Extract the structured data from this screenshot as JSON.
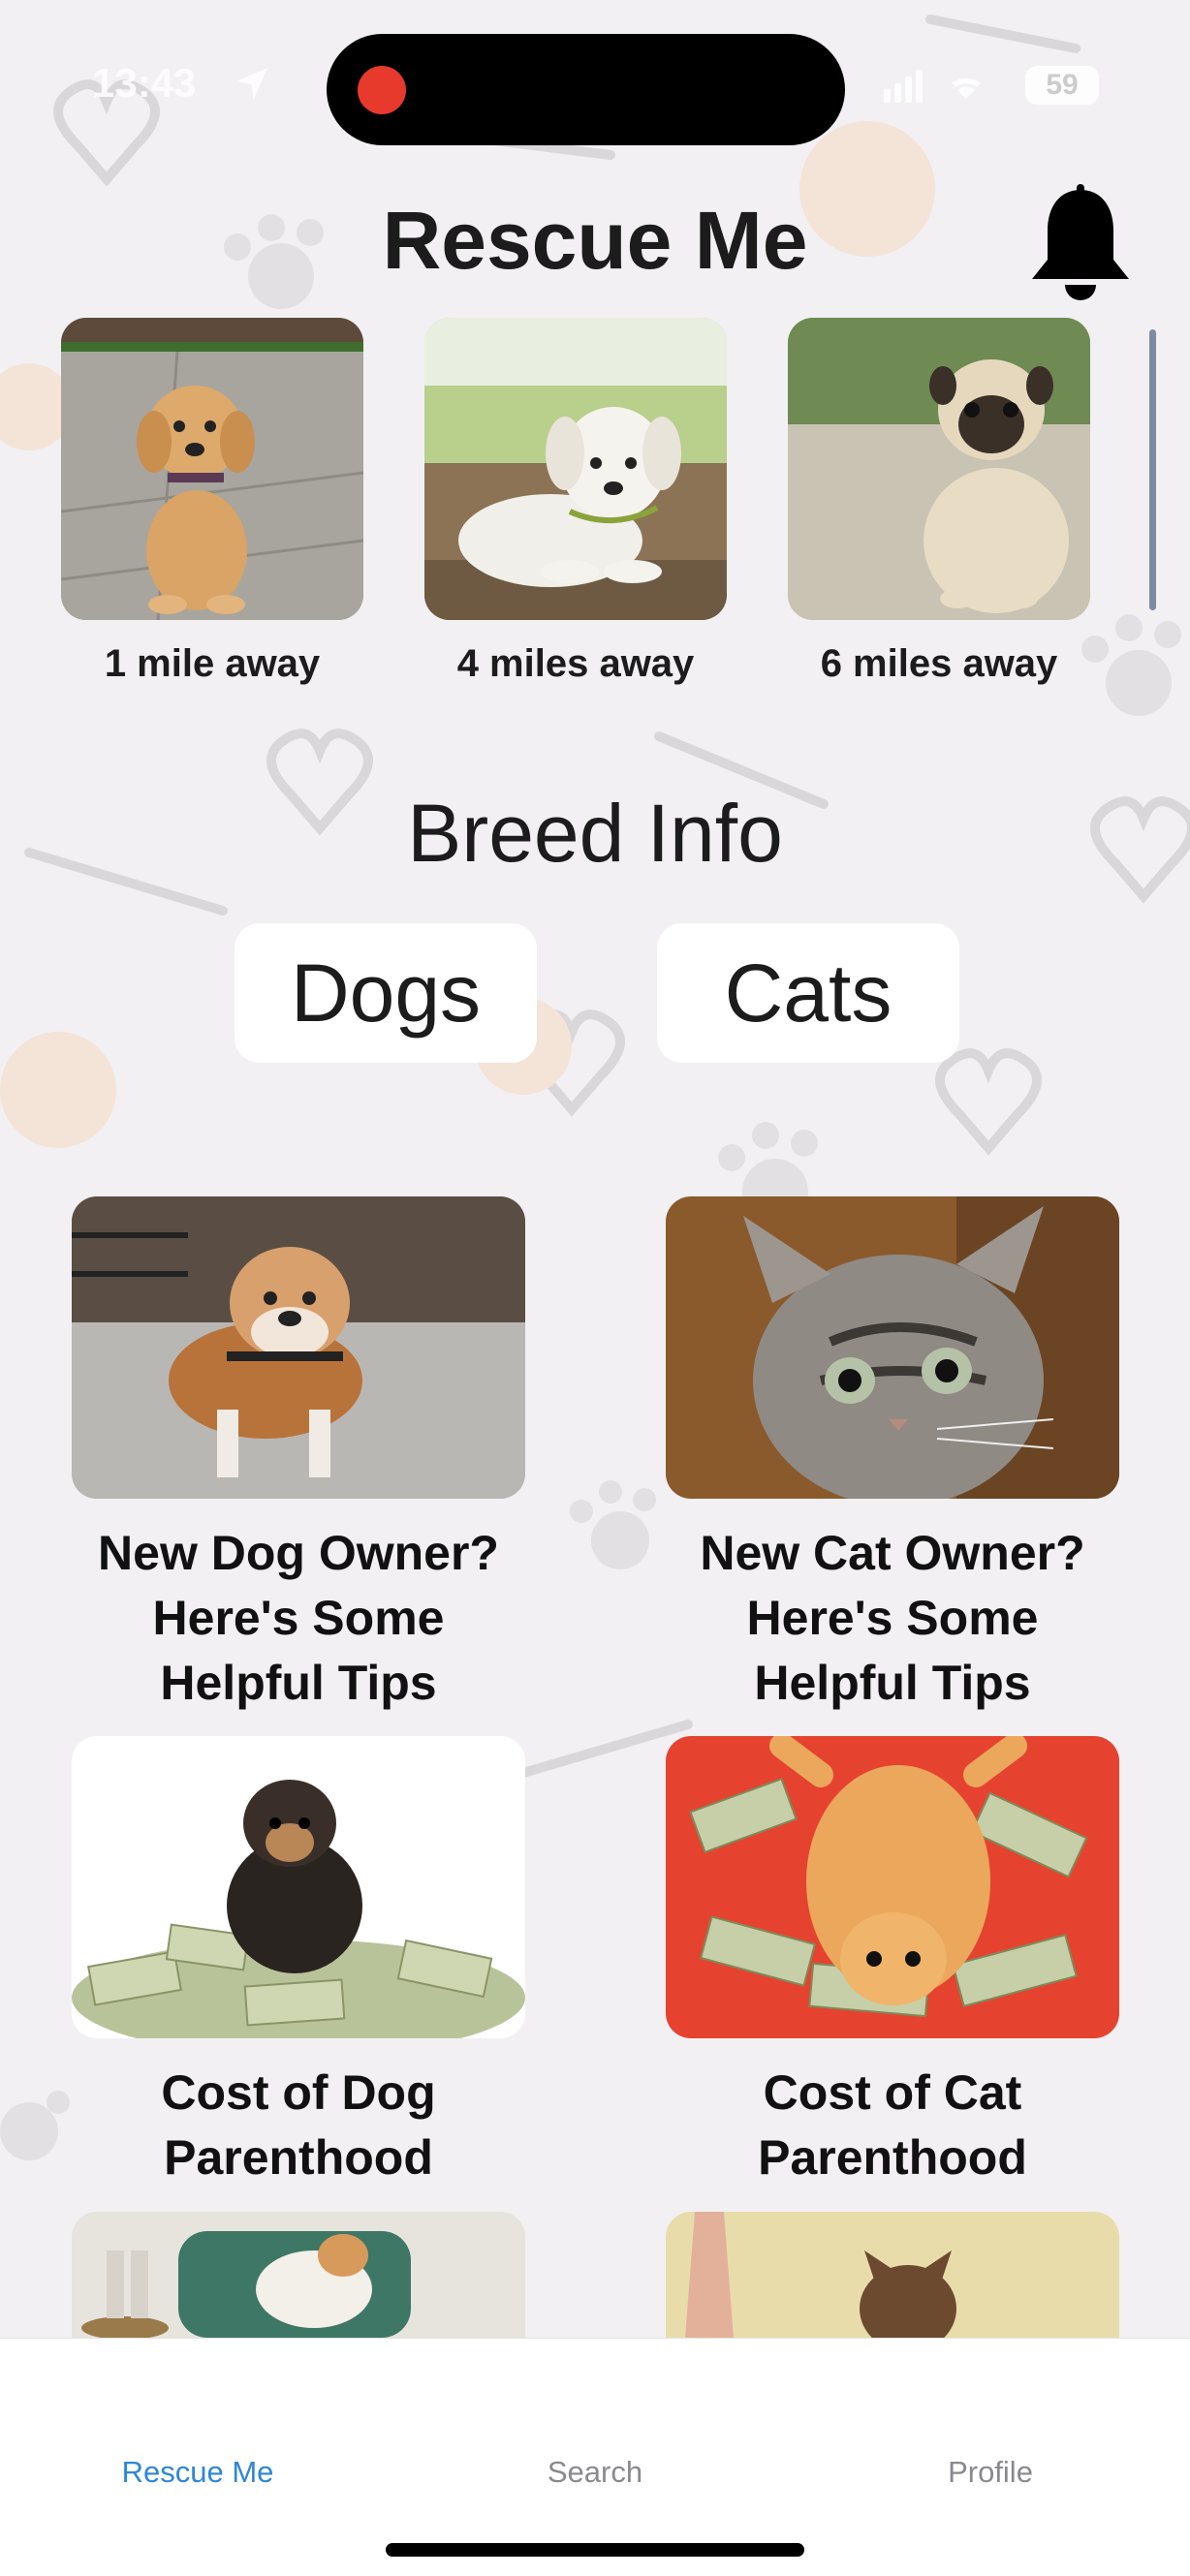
{
  "status_bar": {
    "time": "13:43",
    "battery": "59"
  },
  "header": {
    "title": "Rescue Me",
    "bell_icon": "bell-icon"
  },
  "rescue_pets": [
    {
      "distance": "1 mile away",
      "animal": "golden-retriever-puppy"
    },
    {
      "distance": "4 miles away",
      "animal": "white-labrador-puppy"
    },
    {
      "distance": "6 miles away",
      "animal": "pug"
    }
  ],
  "breed_info": {
    "title": "Breed Info",
    "dogs_label": "Dogs",
    "cats_label": "Cats"
  },
  "articles": [
    {
      "title": "New Dog Owner?\nHere's Some\nHelpful Tips",
      "photo": "bulldog"
    },
    {
      "title": "New Cat Owner?\nHere's Some\nHelpful Tips",
      "photo": "tabby-kitten"
    },
    {
      "title": "Cost of Dog\nParenthood",
      "photo": "puppy-on-money"
    },
    {
      "title": "Cost of Cat\nParenthood",
      "photo": "cat-on-money"
    }
  ],
  "tabs": [
    {
      "label": "Rescue Me",
      "active": true
    },
    {
      "label": "Search",
      "active": false
    },
    {
      "label": "Profile",
      "active": false
    }
  ],
  "colors": {
    "background": "#f2f0f3",
    "accent": "#2f86d6",
    "inactive_tab": "#8a8a8e",
    "recording": "#e8392d"
  }
}
